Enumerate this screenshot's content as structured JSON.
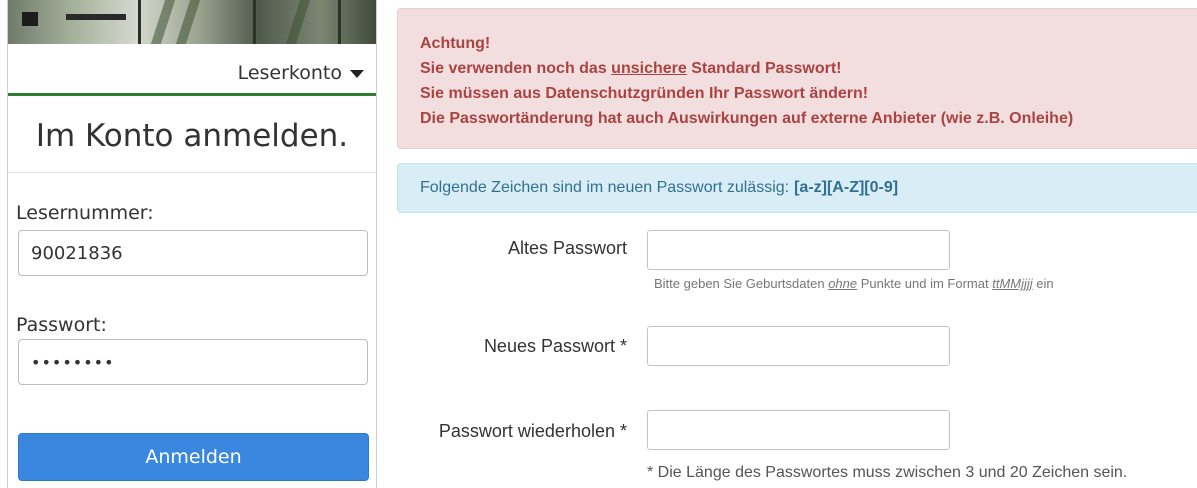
{
  "login": {
    "account_menu_label": "Leserkonto",
    "title": "Im Konto anmelden.",
    "reader_number_label": "Lesernummer:",
    "reader_number_value": "90021836",
    "password_label": "Passwort:",
    "password_value": "••••••••",
    "submit_label": "Anmelden"
  },
  "warning": {
    "line1": "Achtung!",
    "line2_before": "Sie verwenden noch das ",
    "line2_underlined": "unsichere",
    "line2_after": " Standard Passwort!",
    "line3": "Sie müssen aus Datenschutzgründen Ihr Passwort ändern!",
    "line4": "Die Passwortänderung hat auch Auswirkungen auf externe Anbieter (wie z.B. Onleihe)"
  },
  "info": {
    "text": "Folgende Zeichen sind im neuen Passwort zulässig:",
    "allowed_chars": "[a-z][A-Z][0-9]"
  },
  "change_form": {
    "old_password_label": "Altes Passwort",
    "old_password_value": "",
    "help_before": "Bitte geben Sie Geburtsdaten ",
    "help_em1": "ohne",
    "help_middle": " Punkte und im Format ",
    "help_em2": "ttMMjjjj",
    "help_after": " ein",
    "new_password_label": "Neues Passwort *",
    "new_password_value": "",
    "repeat_password_label": "Passwort wiederholen *",
    "repeat_password_value": "",
    "length_note": "* Die Länge des Passwortes muss zwischen 3 und 20 Zeichen sein."
  },
  "colors": {
    "accent_green": "#2e7d32",
    "button_blue": "#3a87e0",
    "danger_bg": "#f2dede",
    "danger_text": "#a94442",
    "info_bg": "#d9edf7",
    "info_text": "#31708f"
  }
}
